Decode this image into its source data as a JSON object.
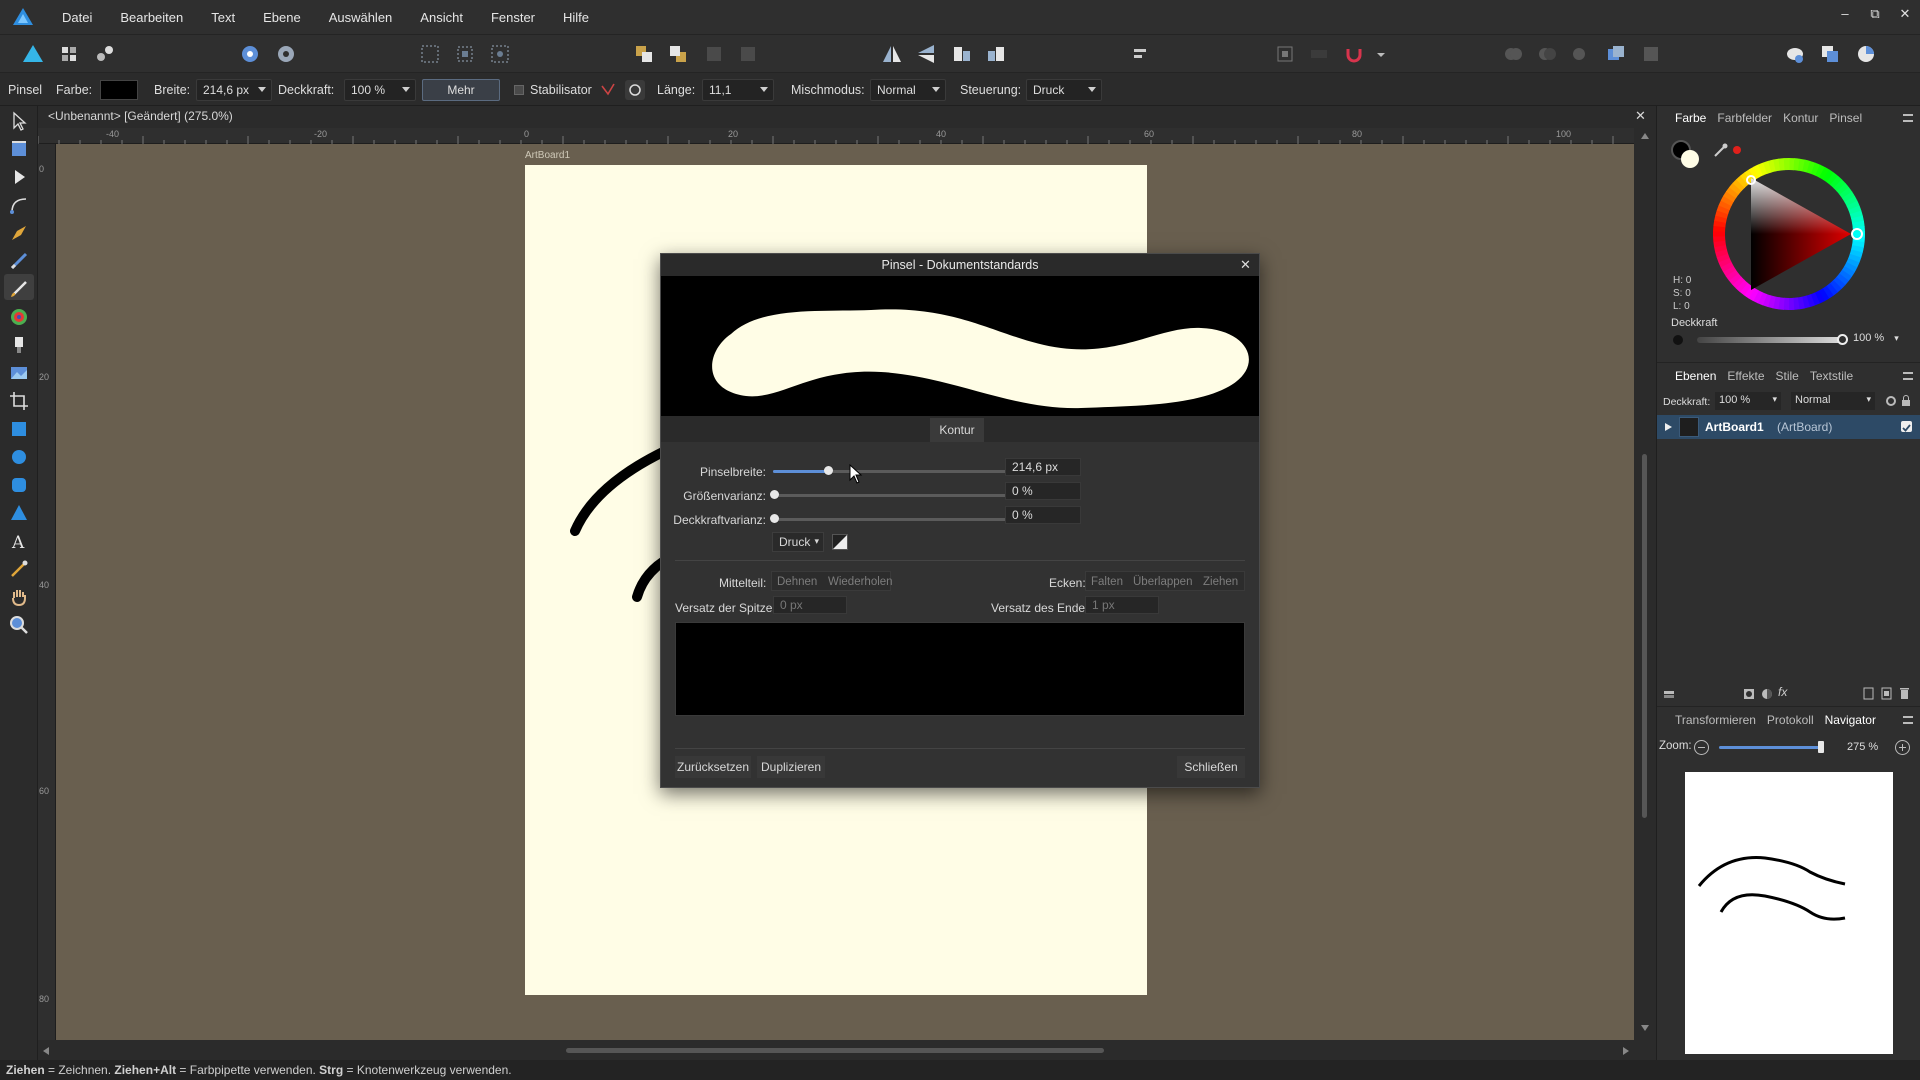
{
  "menubar": {
    "items": [
      "Datei",
      "Bearbeiten",
      "Text",
      "Ebene",
      "Auswählen",
      "Ansicht",
      "Fenster",
      "Hilfe"
    ],
    "window_controls": [
      "–",
      "⧉",
      "✕"
    ]
  },
  "context_toolbar": {
    "tool_name": "Pinsel",
    "color_label": "Farbe:",
    "width_label": "Breite:",
    "width_value": "214,6 px",
    "opacity_label": "Deckkraft:",
    "opacity_value": "100 %",
    "more_label": "Mehr",
    "stabilizer_label": "Stabilisator",
    "length_label": "Länge:",
    "length_value": "11,1",
    "blend_label": "Mischmodus:",
    "blend_value": "Normal",
    "control_label": "Steuerung:",
    "control_value": "Druck"
  },
  "document": {
    "tab_title": "<Unbenannt> [Geändert] (275.0%)",
    "artboard_label": "ArtBoard1",
    "ruler_top_ticks": [
      "-40",
      "-20",
      "0",
      "20",
      "40",
      "60",
      "80",
      "100"
    ],
    "ruler_left_ticks": [
      "0",
      "20",
      "40",
      "60",
      "80"
    ]
  },
  "dialog": {
    "title": "Pinsel - Dokumentstandards",
    "section_tab": "Kontur",
    "brush_width_label": "Pinselbreite:",
    "brush_width_value": "214,6 px",
    "brush_width_fraction": 0.22,
    "size_variance_label": "Größenvarianz:",
    "size_variance_value": "0 %",
    "opacity_variance_label": "Deckkraftvarianz:",
    "opacity_variance_value": "0 %",
    "pressure_label": "Druck",
    "middle_label": "Mittelteil:",
    "middle_opt_1": "Dehnen",
    "middle_opt_2": "Wiederholen",
    "corners_label": "Ecken:",
    "corners_opt_1": "Falten",
    "corners_opt_2": "Überlappen",
    "corners_opt_3": "Ziehen",
    "tip_offset_label": "Versatz der Spitze:",
    "tip_offset_value": "0 px",
    "end_offset_label": "Versatz des Endes:",
    "end_offset_value": "1 px",
    "reset_label": "Zurücksetzen",
    "duplicate_label": "Duplizieren",
    "close_label": "Schließen"
  },
  "color_panel": {
    "tabs": [
      "Farbe",
      "Farbfelder",
      "Kontur",
      "Pinsel"
    ],
    "h": "H: 0",
    "s": "S: 0",
    "l": "L: 0",
    "opacity_label": "Deckkraft",
    "opacity_value": "100 %"
  },
  "layers_panel": {
    "tabs": [
      "Ebenen",
      "Effekte",
      "Stile",
      "Textstile"
    ],
    "opacity_label": "Deckkraft:",
    "opacity_value": "100 %",
    "blend_value": "Normal",
    "layer_name": "ArtBoard1",
    "layer_type": "(ArtBoard)"
  },
  "navigator_panel": {
    "tabs": [
      "Transformieren",
      "Protokoll",
      "Navigator"
    ],
    "zoom_label": "Zoom:",
    "zoom_value": "275 %"
  },
  "status": {
    "b1": "Ziehen",
    "t1": " = Zeichnen. ",
    "b2": "Ziehen+Alt",
    "t2": " = Farbpipette verwenden. ",
    "b3": "Strg",
    "t3": " = Knotenwerkzeug verwenden."
  },
  "colors": {
    "canvas_bg": "#695f4f",
    "artboard": "#fffde6",
    "accent": "#5d8fd8",
    "selected_row": "#2d4a66"
  }
}
